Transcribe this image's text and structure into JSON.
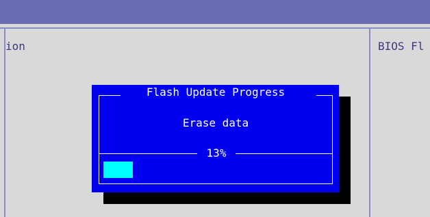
{
  "main_panel": {
    "title_fragment": "ion"
  },
  "help_panel": {
    "title_fragment": "BIOS Fl"
  },
  "dialog": {
    "title": "Flash Update Progress",
    "message": "Erase data",
    "progress": {
      "percent_label": "13%",
      "value": 0.13
    }
  },
  "colors": {
    "top_band": "#6b6bb3",
    "panel_border": "#8b8bc8",
    "panel_background": "#d9d9d9",
    "panel_text": "#3b3b80",
    "dialog_background": "#0000ee",
    "dialog_shadow": "#000000",
    "dialog_text": "#ffffff",
    "progress_fill": "#00ffff"
  }
}
